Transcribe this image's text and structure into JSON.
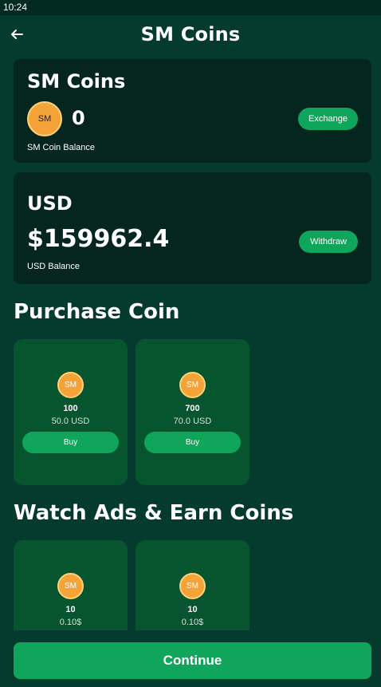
{
  "status_bar": {
    "time": "10:24"
  },
  "header": {
    "title": "SM Coins",
    "back_icon": "arrow-left-icon"
  },
  "coins_card": {
    "title": "SM Coins",
    "coin_icon_text": "SM",
    "balance": "0",
    "balance_label": "SM Coin Balance",
    "exchange_label": "Exchange"
  },
  "usd_card": {
    "title": "USD",
    "amount": "$159962.4",
    "balance_label": "USD Balance",
    "withdraw_label": "Withdraw"
  },
  "purchase": {
    "title": "Purchase Coin",
    "offers": [
      {
        "coin_text": "SM",
        "amount": "100",
        "price": "50.0 USD",
        "buy_label": "Buy"
      },
      {
        "coin_text": "SM",
        "amount": "700",
        "price": "70.0 USD",
        "buy_label": "Buy"
      }
    ]
  },
  "ads": {
    "title": "Watch Ads & Earn Coins",
    "offers": [
      {
        "coin_text": "SM",
        "amount": "10",
        "price": "0.10$"
      },
      {
        "coin_text": "SM",
        "amount": "10",
        "price": "0.10$"
      }
    ]
  },
  "footer": {
    "continue_label": "Continue"
  },
  "colors": {
    "background": "#053a2e",
    "card": "#04261e",
    "offer_card": "#06552f",
    "accent": "#0fa55a",
    "coin": "#f4a338"
  }
}
